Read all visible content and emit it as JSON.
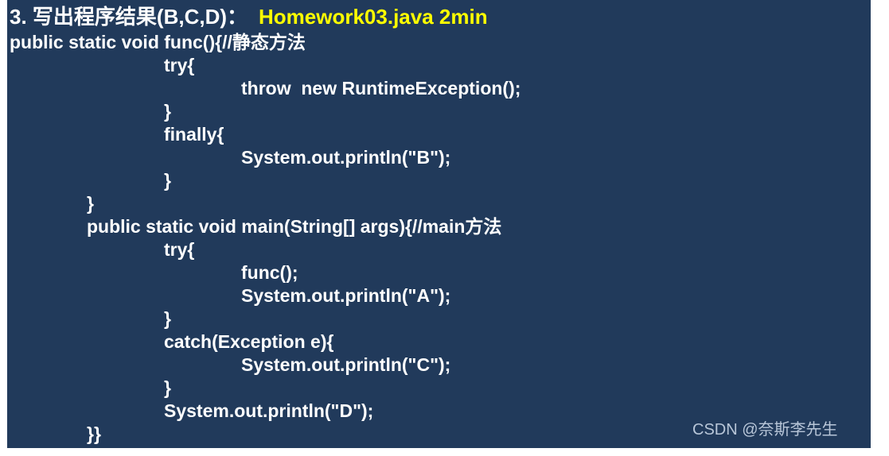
{
  "title": {
    "question": "3. 写出程序结果(B,C,D)：",
    "file": "Homework03.java 2min"
  },
  "colors": {
    "background": "#213a5b",
    "text": "#ffffff",
    "accent": "#ffff00",
    "watermark": "#b8c6d8"
  },
  "code": {
    "lines": [
      "public static void func(){//静态方法",
      "try{",
      "throw  new RuntimeException();",
      "}",
      "finally{",
      "System.out.println(\"B\");",
      "}",
      "}",
      "public static void main(String[] args){//main方法",
      "try{",
      "func();",
      "System.out.println(\"A\");",
      "}",
      "catch(Exception e){",
      "System.out.println(\"C\");",
      "}",
      "System.out.println(\"D\");",
      "}}"
    ]
  },
  "watermark": "CSDN @奈斯李先生"
}
